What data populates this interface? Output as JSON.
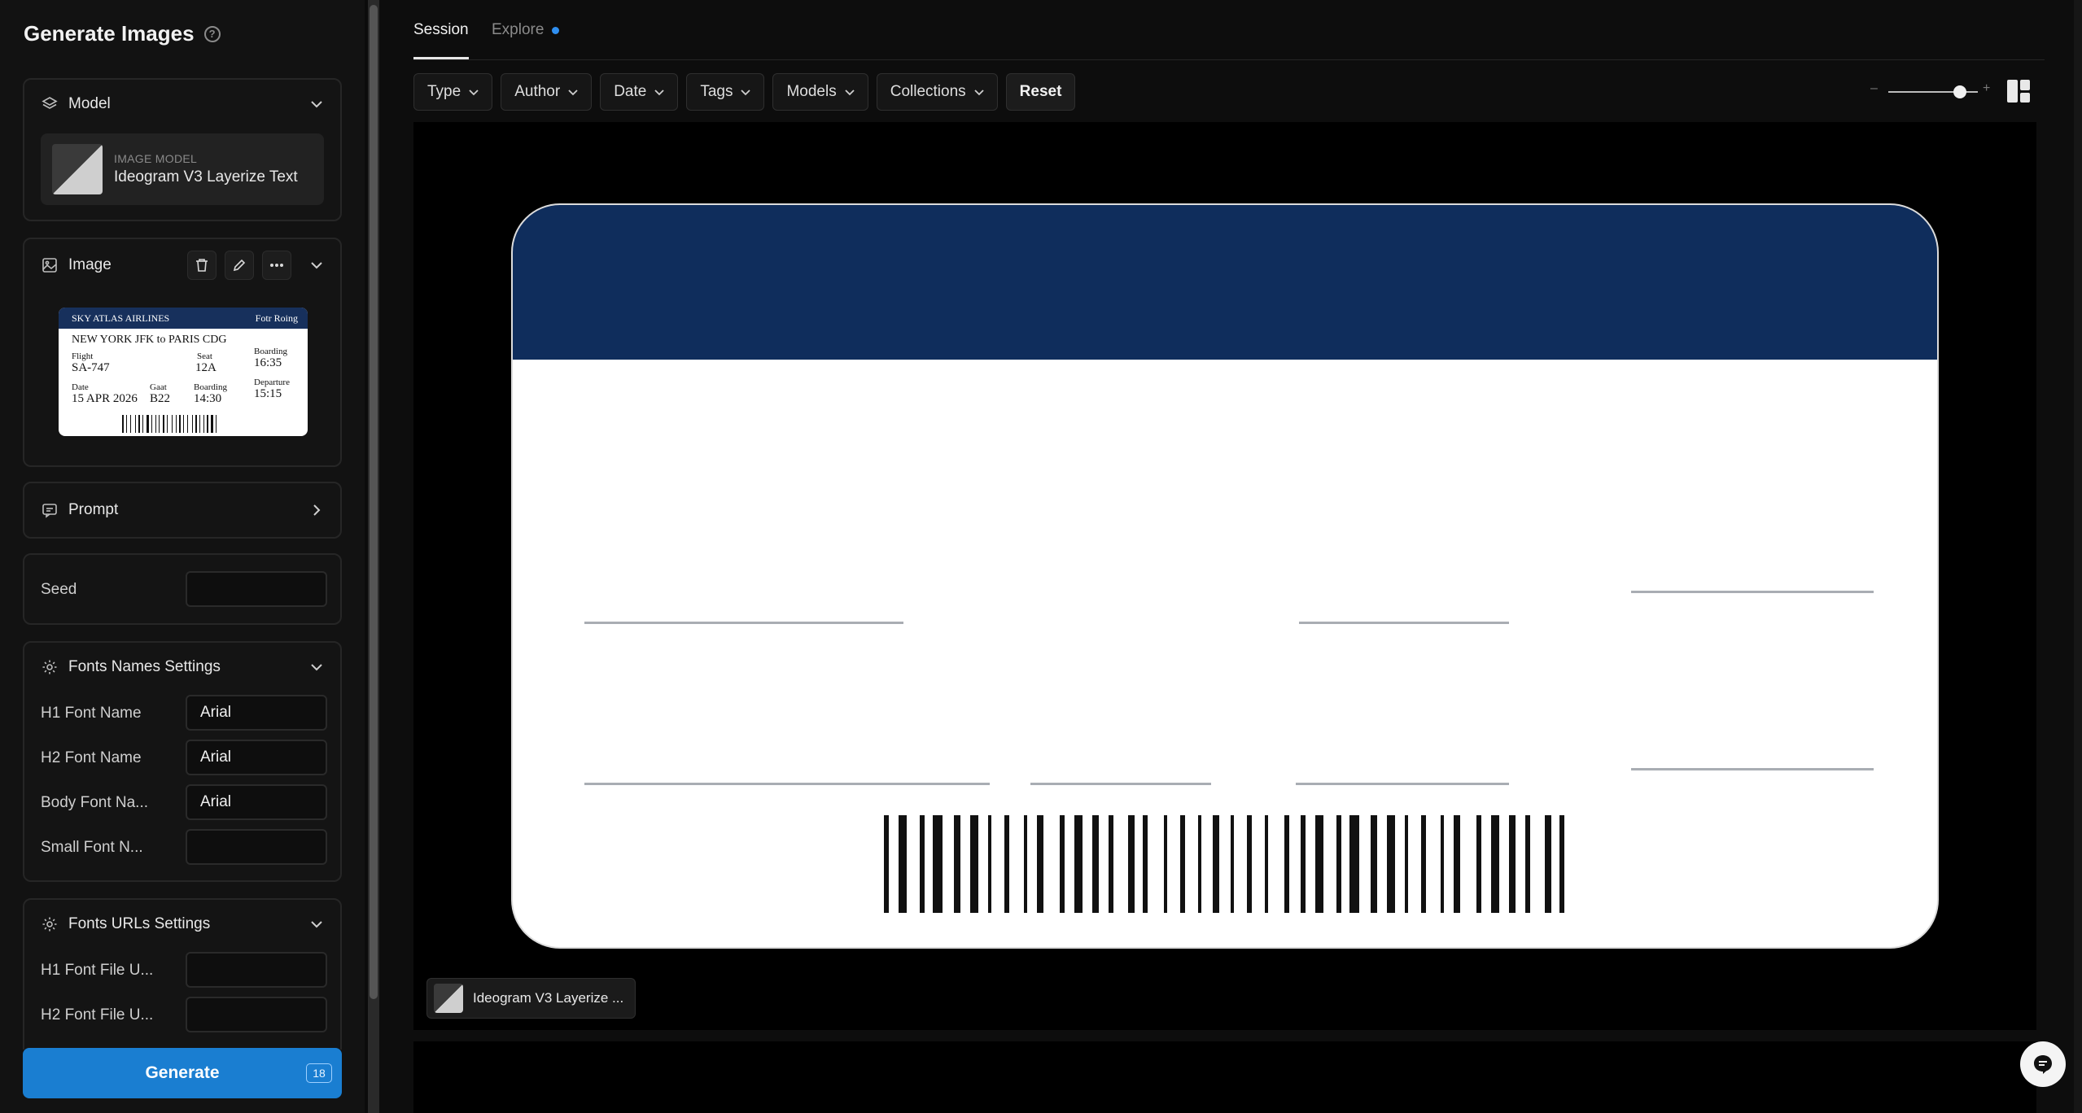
{
  "sidebar": {
    "title": "Generate Images",
    "help_icon": "help-circle-icon",
    "model_panel": {
      "heading": "Model",
      "icon": "layers-icon",
      "card_caption": "IMAGE MODEL",
      "card_name": "Ideogram V3 Layerize Text"
    },
    "image_panel": {
      "heading": "Image",
      "icon": "image-icon",
      "actions": [
        "trash-icon",
        "pencil-icon",
        "more-icon"
      ],
      "ticket": {
        "airline": "SKY ATLAS AIRLINES",
        "name": "Fotr Roing",
        "route": "NEW YORK JFK to PARIS CDG",
        "flight_label": "Flight",
        "flight": "SA-747",
        "seat_label": "Seat",
        "seat": "12A",
        "boarding_label": "Boarding",
        "boarding": "16:35",
        "date_label": "Date",
        "date": "15 APR 2026",
        "gate_label": "Gaat",
        "gate": "B22",
        "boarding2_label": "Boarding",
        "boarding2": "14:30",
        "departure_label": "Departure",
        "departure": "15:15"
      }
    },
    "prompt_panel": {
      "heading": "Prompt",
      "icon": "message-icon"
    },
    "seed": {
      "label": "Seed",
      "value": ""
    },
    "fonts_names": {
      "heading": "Fonts Names Settings",
      "icon": "gear-icon",
      "fields": [
        {
          "label": "H1 Font Name",
          "value": "Arial"
        },
        {
          "label": "H2 Font Name",
          "value": "Arial"
        },
        {
          "label": "Body Font Na...",
          "value": "Arial"
        },
        {
          "label": "Small Font N...",
          "value": ""
        }
      ]
    },
    "fonts_urls": {
      "heading": "Fonts URLs Settings",
      "icon": "gear-icon",
      "fields": [
        {
          "label": "H1 Font File U...",
          "value": ""
        },
        {
          "label": "H2 Font File U...",
          "value": ""
        }
      ]
    },
    "generate": {
      "label": "Generate",
      "count": "18"
    }
  },
  "main": {
    "tabs": [
      {
        "label": "Session",
        "active": true
      },
      {
        "label": "Explore",
        "active": false,
        "dot_color": "#2f8ff0"
      }
    ],
    "filters": [
      "Type",
      "Author",
      "Date",
      "Tags",
      "Models",
      "Collections"
    ],
    "reset_label": "Reset",
    "zoom": {
      "minus": "–",
      "plus": "+",
      "level": 0.85
    },
    "layout_icon": "layout-grid-icon",
    "result": {
      "band_color": "#0f2d5c",
      "chip_label": "Ideogram V3 Layerize ..."
    },
    "chat_icon": "chat-icon"
  }
}
